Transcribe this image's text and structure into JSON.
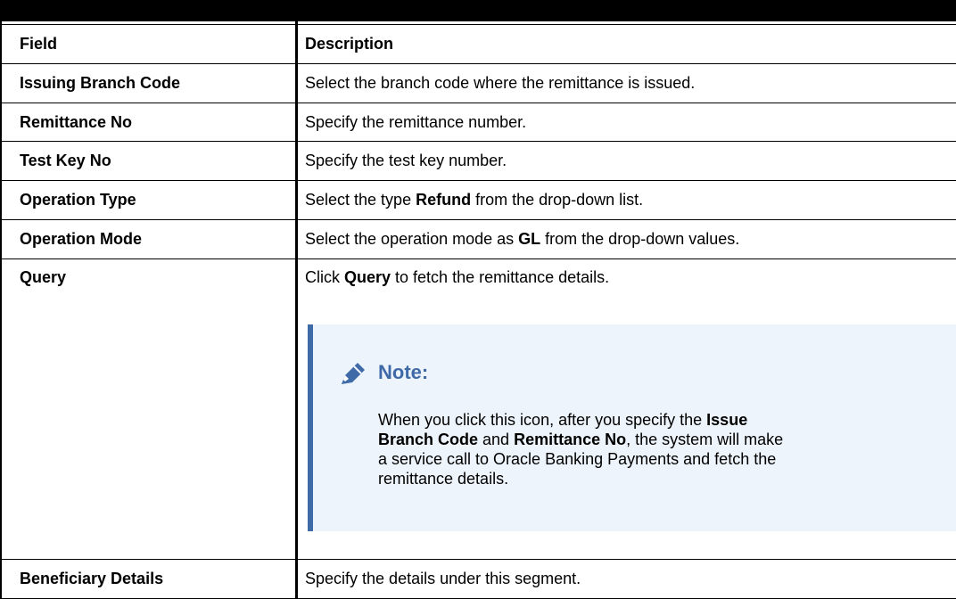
{
  "header": {
    "field": "Field",
    "description": "Description"
  },
  "rows": [
    {
      "field": "Issuing Branch Code",
      "description": "Select the branch code where the remittance is issued."
    },
    {
      "field": "Remittance No",
      "description": "Specify the remittance number."
    },
    {
      "field": "Test Key No",
      "description": "Specify the test key number."
    },
    {
      "field": "Operation Type",
      "desc_pre": "Select the type ",
      "desc_bold": "Refund",
      "desc_post": " from the drop-down list."
    },
    {
      "field": "Operation Mode",
      "desc_pre": "Select the operation mode as ",
      "desc_bold": "GL",
      "desc_post": " from the drop-down values."
    },
    {
      "field": "Query",
      "desc_pre": "Click ",
      "desc_bold": "Query",
      "desc_post": " to fetch the remittance details."
    },
    {
      "field": "Beneficiary Details",
      "description": "Specify the details under this segment."
    }
  ],
  "note": {
    "title": "Note:",
    "icon": "pencil-icon",
    "line1_pre": "When you click this icon, after you specify the ",
    "line1_bold": "Issue",
    "line2_bold_a": "Branch Code",
    "line2_mid": " and ",
    "line2_bold_b": "Remittance No",
    "line2_post": ", the system will make",
    "line3": "a service call to Oracle Banking Payments and fetch the",
    "line4": "remittance details."
  },
  "colors": {
    "note_accent": "#3f6aa8",
    "note_bg": "#eef4fb"
  }
}
